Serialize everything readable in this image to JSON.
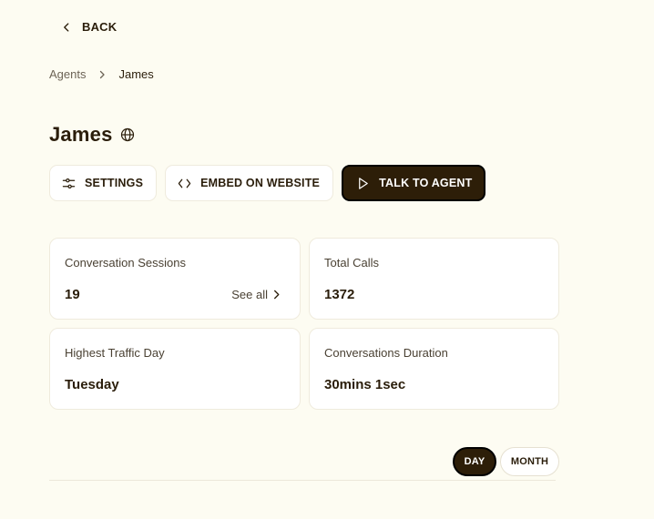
{
  "nav": {
    "back_label": "BACK"
  },
  "breadcrumb": {
    "parent": "Agents",
    "current": "James"
  },
  "agent": {
    "name": "James"
  },
  "actions": {
    "settings_label": "SETTINGS",
    "embed_label": "EMBED ON WEBSITE",
    "talk_label": "TALK TO AGENT"
  },
  "stats": {
    "sessions": {
      "label": "Conversation Sessions",
      "value": "19",
      "link": "See all"
    },
    "calls": {
      "label": "Total Calls",
      "value": "1372"
    },
    "traffic": {
      "label": "Highest Traffic Day",
      "value": "Tuesday"
    },
    "duration": {
      "label": "Conversations Duration",
      "value": "30mins 1sec"
    }
  },
  "period_toggle": {
    "day_label": "DAY",
    "month_label": "MONTH",
    "selected": "DAY"
  },
  "icons": {
    "back": "chevron-left-icon",
    "breadcrumb_separator": "chevron-right-icon",
    "public": "globe-icon",
    "settings": "sliders-icon",
    "embed": "code-icon",
    "talk": "play-icon",
    "see_all": "chevron-right-icon"
  },
  "colors": {
    "background": "#fdfcf2",
    "primary": "#2d1e08",
    "text": "#2a1d0a",
    "muted_text": "#6d6456",
    "card_border": "#efebdd"
  }
}
